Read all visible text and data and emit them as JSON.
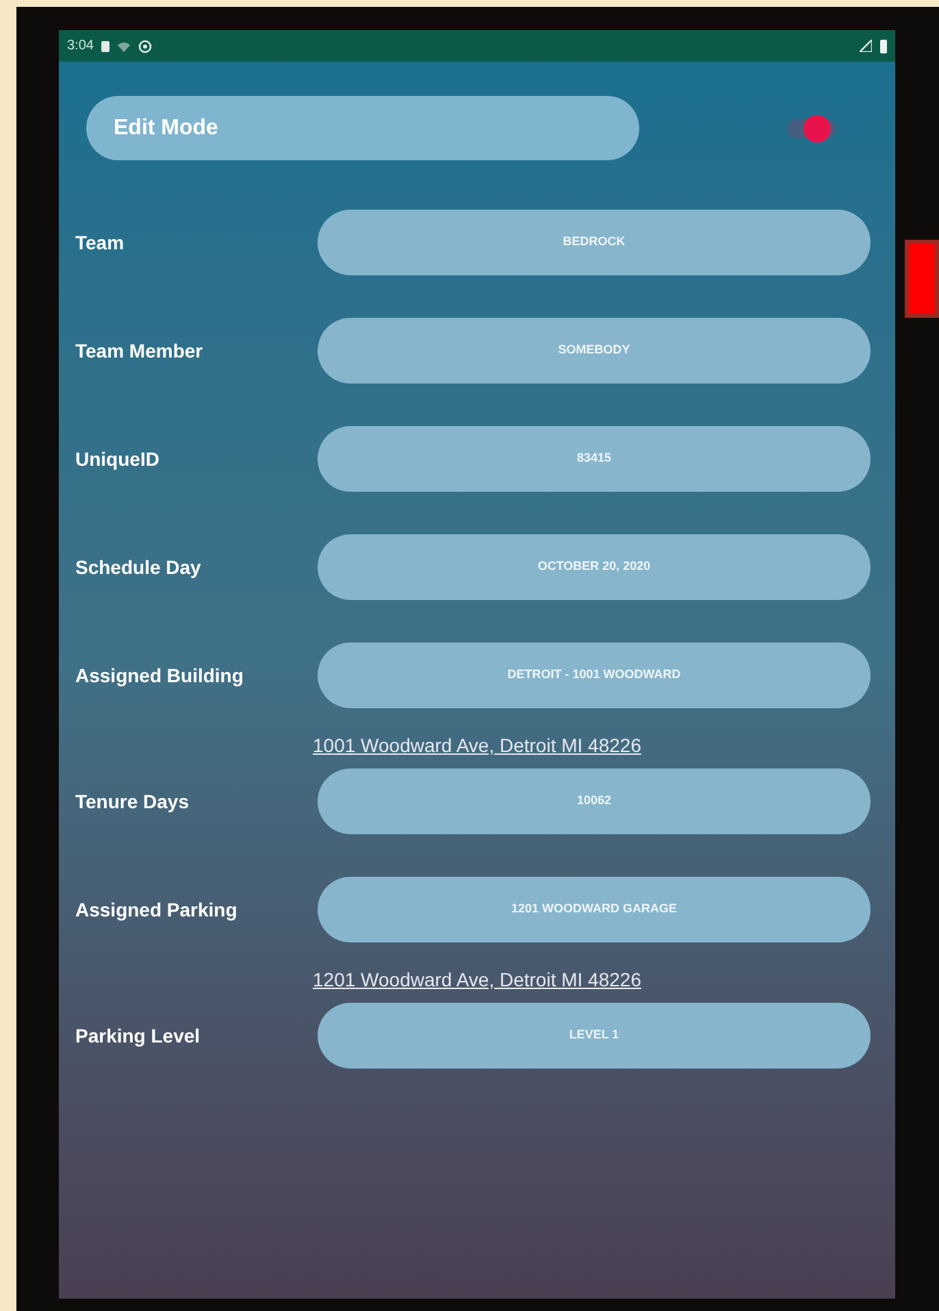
{
  "status_bar": {
    "time": "3:04"
  },
  "edit_mode": {
    "label": "Edit Mode",
    "on": true
  },
  "rows": [
    {
      "kind": "field",
      "label": "Team",
      "value": "BEDROCK"
    },
    {
      "kind": "field",
      "label": "Team Member",
      "value": "SOMEBODY"
    },
    {
      "kind": "field",
      "label": "UniqueID",
      "value": "83415"
    },
    {
      "kind": "field",
      "label": "Schedule Day",
      "value": "OCTOBER 20, 2020"
    },
    {
      "kind": "field",
      "label": "Assigned Building",
      "value": "DETROIT - 1001 WOODWARD"
    },
    {
      "kind": "link",
      "text": "1001 Woodward Ave, Detroit MI 48226"
    },
    {
      "kind": "field",
      "label": "Tenure Days",
      "value": "10062"
    },
    {
      "kind": "field",
      "label": "Assigned Parking",
      "value": "1201 WOODWARD GARAGE"
    },
    {
      "kind": "link",
      "text": "1201 Woodward Ave, Detroit MI 48226"
    },
    {
      "kind": "field",
      "label": "Parking Level",
      "value": "LEVEL 1"
    }
  ]
}
